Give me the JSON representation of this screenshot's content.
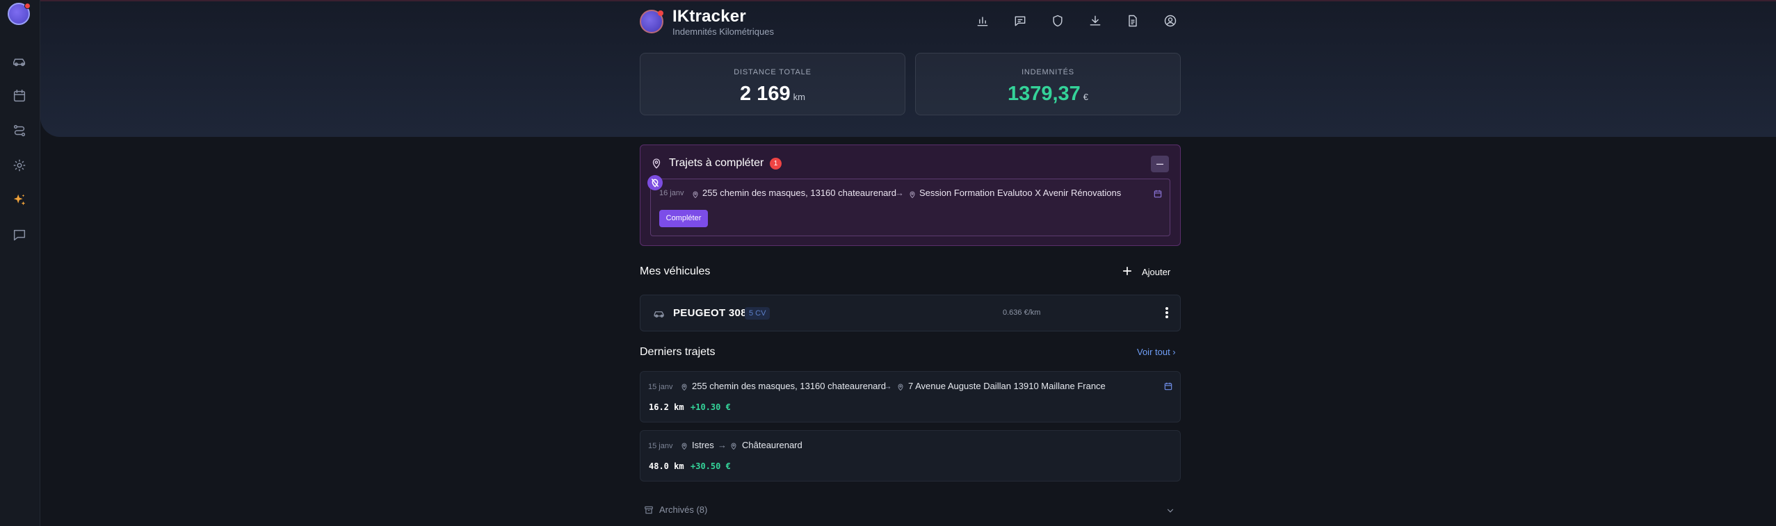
{
  "app": {
    "title": "IKtracker",
    "subtitle": "Indemnités Kilométriques"
  },
  "sidebar": {
    "items": [
      {
        "icon": "car-icon"
      },
      {
        "icon": "calendar-icon"
      },
      {
        "icon": "route-icon"
      },
      {
        "icon": "gear-icon"
      },
      {
        "icon": "sparkles-icon",
        "active": true
      },
      {
        "icon": "chat-icon"
      }
    ]
  },
  "header_icons": [
    "bar-chart-icon",
    "chat-icon",
    "shield-icon",
    "download-icon",
    "document-icon",
    "user-circle-icon"
  ],
  "stats": {
    "distance": {
      "label": "DISTANCE TOTALE",
      "value": "2 169",
      "unit": "km"
    },
    "indemnites": {
      "label": "INDEMNITÉS",
      "value": "1379,37",
      "unit": "€"
    }
  },
  "pending": {
    "title": "Trajets à compléter",
    "count": "1",
    "collapse_label": "–",
    "trip": {
      "date": "16 janv",
      "from": "255 chemin des masques, 13160 chateaurenard",
      "arrow": "→",
      "to": "Session Formation Evalutoo X Avenir Rénovations",
      "button": "Compléter"
    }
  },
  "vehicles": {
    "title": "Mes véhicules",
    "add_label": "Ajouter",
    "items": [
      {
        "name": "PEUGEOT 308",
        "cv": "5 CV",
        "rate": "0.636 €/km"
      }
    ]
  },
  "recent": {
    "title": "Derniers trajets",
    "see_all": "Voir tout ›",
    "trips": [
      {
        "date": "15 janv",
        "from": "255 chemin des masques, 13160 chateaurenard",
        "arrow": "→",
        "to": "7 Avenue Auguste Daillan 13910 Maillane France",
        "km": "16.2 km",
        "amount": "+10.30 €"
      },
      {
        "date": "15 janv",
        "from": "Istres",
        "arrow": "→",
        "to": "Châteaurenard",
        "km": "48.0 km",
        "amount": "+30.50 €"
      }
    ]
  },
  "archives": {
    "label": "Archivés (8)"
  },
  "colors": {
    "background": "#12151c",
    "accent_purple": "#7c4de8",
    "green": "#34d399",
    "link_blue": "#6f9ef6",
    "badge_red": "#ef4444"
  }
}
